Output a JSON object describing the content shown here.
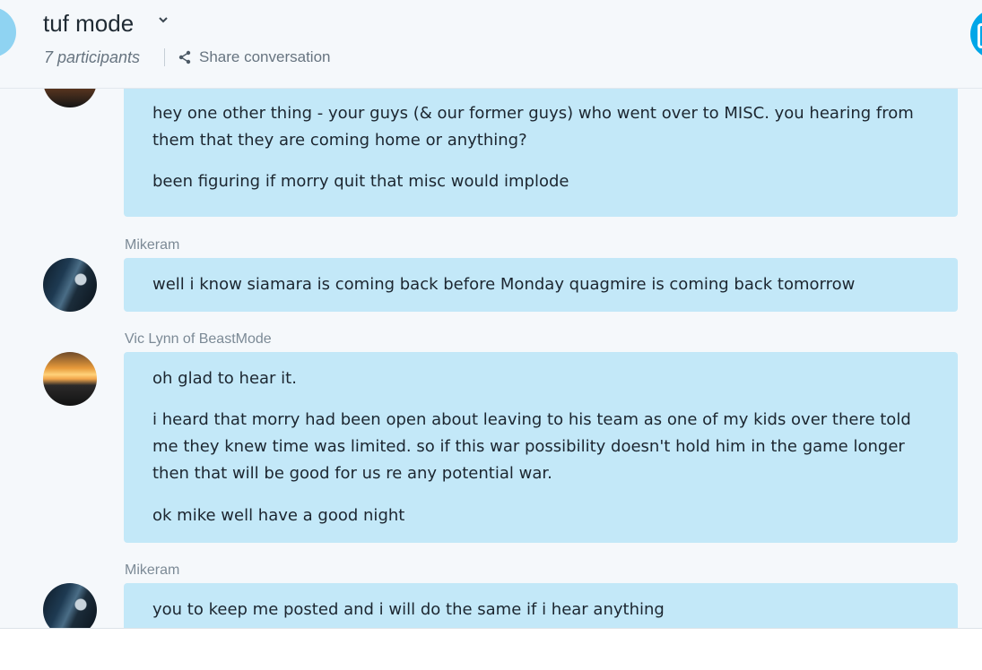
{
  "header": {
    "title": "tuf mode",
    "participants": "7 participants",
    "share_label": "Share conversation"
  },
  "messages": [
    {
      "sender": "",
      "paragraphs": [
        "hey one other thing - your guys (& our former guys) who went over to MISC.  you hearing from them that they are coming home or anything?",
        "been figuring if morry quit that misc would implode"
      ]
    },
    {
      "sender": "Mikeram",
      "paragraphs": [
        "well i know siamara is coming back before Monday quagmire is coming back tomorrow"
      ]
    },
    {
      "sender": "Vic Lynn of BeastMode",
      "paragraphs": [
        "oh glad to hear it.",
        "i heard that morry had been open about leaving to his team as one of my kids over there told me they knew time was limited.   so if this war possibility doesn't hold him in the game longer then that will be good for us re any potential war.",
        "ok mike well have a good night"
      ]
    },
    {
      "sender": "Mikeram",
      "paragraphs": [
        "you to keep me posted and i will do the same if i hear anything"
      ]
    }
  ],
  "colors": {
    "bubble": "#c3e8f8",
    "background": "#f5f8fb",
    "accent": "#00a6e8"
  },
  "icons": [
    "chevron-down-icon",
    "share-icon"
  ]
}
